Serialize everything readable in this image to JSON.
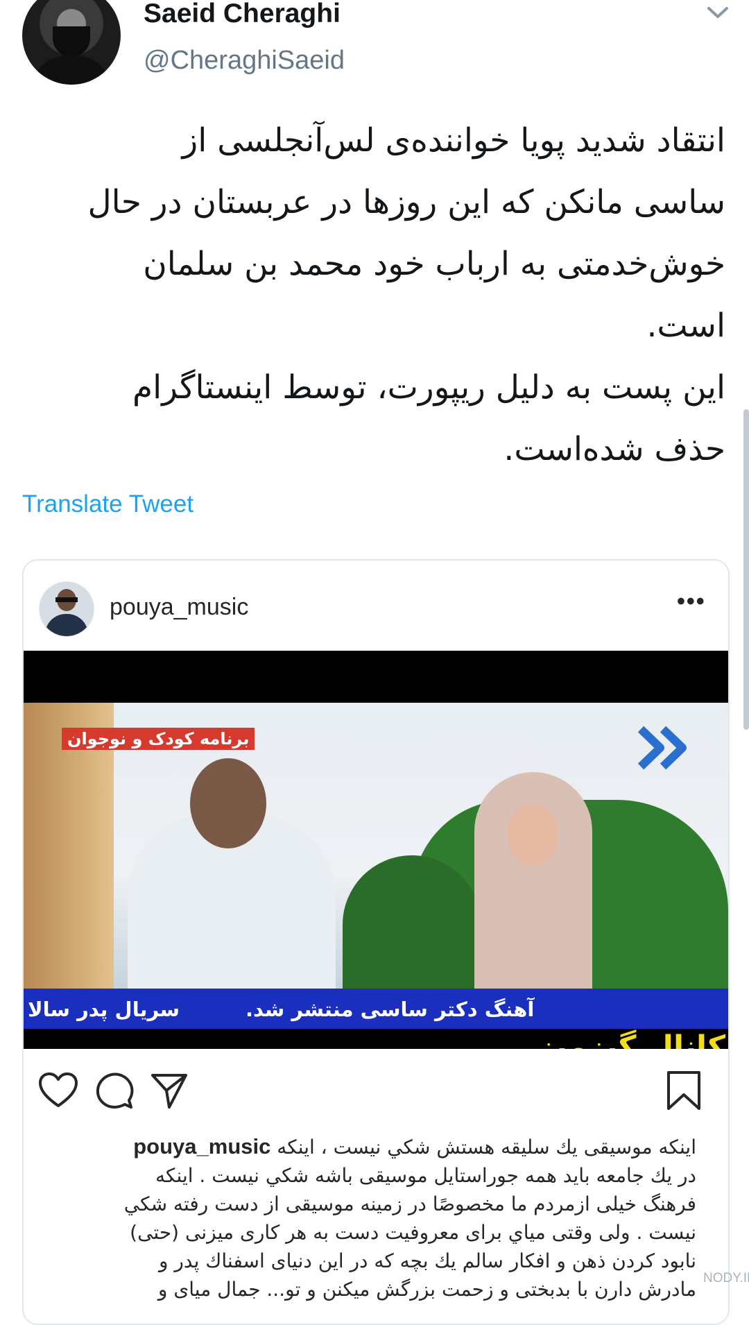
{
  "tweet": {
    "author_name": "Saeid Cheraghi",
    "author_handle": "@CheraghiSaeid",
    "text_lines": [
      "انتقاد شدید پویا خواننده‌ی لس‌آنجلسی از",
      "ساسی مانکن که این روزها در عربستان در حال",
      "خوش‌خدمتی به ارباب خود محمد بن سلمان",
      "است.",
      "این پست به دلیل ریپورت، توسط اینستاگرام",
      "حذف شده‌است."
    ],
    "translate_label": "Translate Tweet"
  },
  "instagram": {
    "username": "pouya_music",
    "more_label": "•••",
    "video": {
      "kids_program_label": "برنامه کودک و نوجوان",
      "ticker_main": "آهنگ دکتر ساسی منتشر شد.",
      "ticker_side": "سریال پدر سالا",
      "channel_label": "کانال گیزمیز"
    },
    "caption": {
      "username": "pouya_music",
      "lines": [
        "اینکه موسیقی یك سلیقه هستش شكي نیست ، اینکه",
        "در یك جامعه باید همه جوراستایل موسیقی باشه شكي نیست . اینکه",
        "فرهنگ خیلی ازمردم ما  مخصوصًا در زمینه موسیقی از دست رفته شكي",
        "نیست . ولی وقتی  میاي برای معروفیت دست به هر کاری میزنی (حتی)",
        "نابود کردن ذهن و افکار سالم یك بچه که در این دنیای اسفناك پدر و",
        "مادرش دارن با بدبختی و زحمت بزرگش میکنن و تو... جمال  میای و"
      ]
    }
  },
  "watermark": "NODY.IR",
  "colors": {
    "link": "#1da1f2",
    "handle": "#657786",
    "ticker": "#1b2fbf",
    "channel": "#f2dd1b"
  },
  "icons": [
    "chevron-down-icon",
    "more-icon",
    "heart-icon",
    "comment-icon",
    "share-icon",
    "bookmark-icon"
  ]
}
